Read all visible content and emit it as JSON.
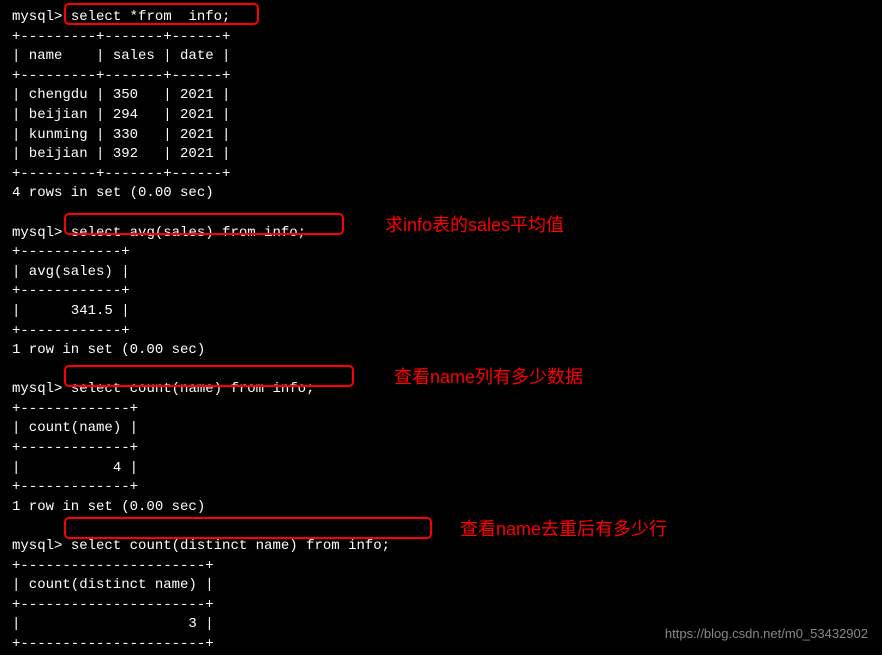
{
  "terminal": {
    "prompt": "mysql>",
    "query1": {
      "text": "select *from  info;",
      "table_border": "+---------+-------+------+",
      "header": "| name    | sales | date |",
      "rows": [
        "| chengdu | 350   | 2021 |",
        "| beijian | 294   | 2021 |",
        "| kunming | 330   | 2021 |",
        "| beijian | 392   | 2021 |"
      ],
      "footer": "4 rows in set (0.00 sec)"
    },
    "query2": {
      "text": "select avg(sales) from info;",
      "table_border": "+------------+",
      "header": "| avg(sales) |",
      "value": "|      341.5 |",
      "footer": "1 row in set (0.00 sec)"
    },
    "query3": {
      "text": "select count(name) from info;",
      "table_border": "+-------------+",
      "header": "| count(name) |",
      "value": "|           4 |",
      "footer": "1 row in set (0.00 sec)"
    },
    "query4": {
      "text": "select count(distinct name) from info;",
      "table_border": "+----------------------+",
      "header": "| count(distinct name) |",
      "value": "|                    3 |"
    }
  },
  "annotations": {
    "a1": "求info表的sales平均值",
    "a2": "查看name列有多少数据",
    "a3": "查看name去重后有多少行"
  },
  "watermark": "https://blog.csdn.net/m0_53432902"
}
